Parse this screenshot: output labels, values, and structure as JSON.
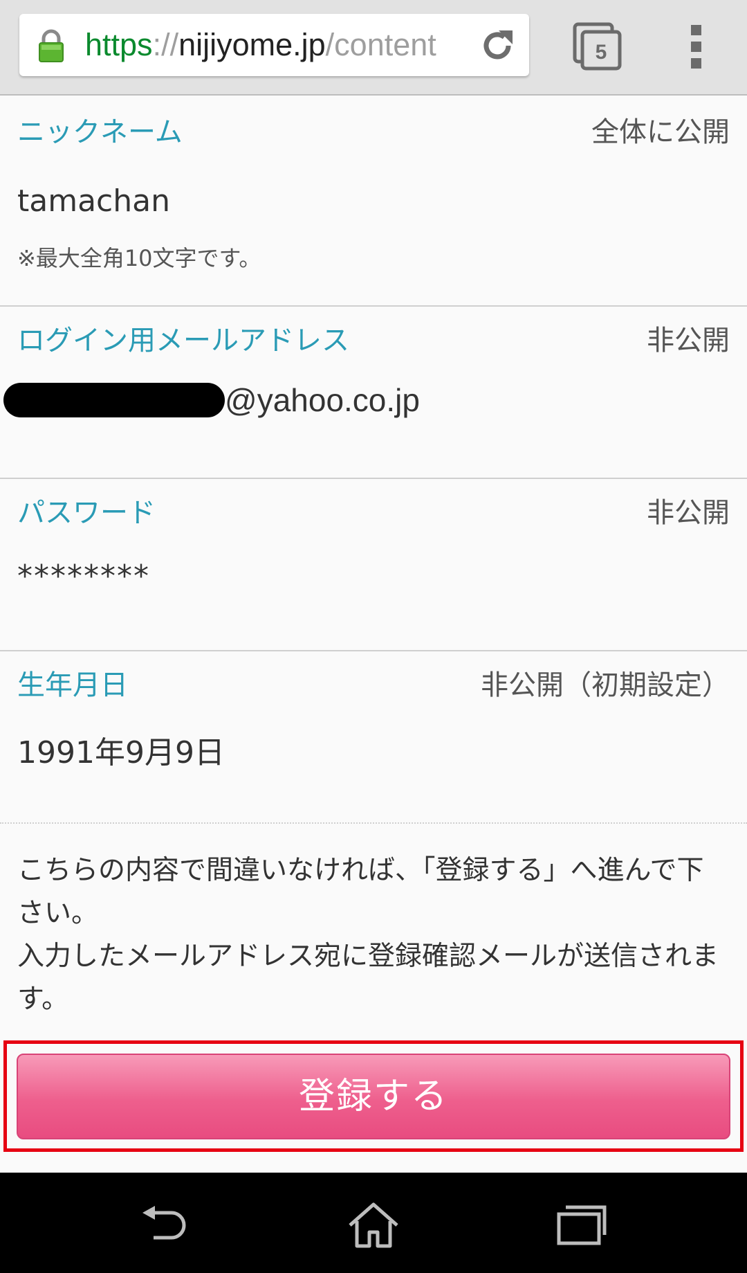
{
  "browser": {
    "url_scheme": "https",
    "url_separator": "://",
    "url_host": "nijiyome.jp",
    "url_path": "/content",
    "tab_count": "5",
    "icons": [
      "lock-icon",
      "reload-icon",
      "tabs-icon",
      "overflow-menu-icon"
    ]
  },
  "form": {
    "nickname": {
      "label": "ニックネーム",
      "visibility": "全体に公開",
      "value": "tamachan",
      "note": "※最大全角10文字です。"
    },
    "email": {
      "label": "ログイン用メールアドレス",
      "visibility": "非公開",
      "value_domain": "@yahoo.co.jp"
    },
    "password": {
      "label": "パスワード",
      "visibility": "非公開",
      "value": "********"
    },
    "birthday": {
      "label": "生年月日",
      "visibility": "非公開（初期設定）",
      "value": "1991年9月9日"
    }
  },
  "notice": {
    "line1": "こちらの内容で間違いなければ、「登録する」へ進んで下さい。",
    "line2": "入力したメールアドレス宛に登録確認メールが送信されます。"
  },
  "register_button_label": "登録する",
  "colors": {
    "label": "#2a9bb5",
    "button": "#ee5f8d",
    "highlight": "#e60012",
    "url_scheme": "#0b8a2e"
  },
  "navbar": {
    "icons": [
      "back-icon",
      "home-icon",
      "recent-apps-icon"
    ]
  }
}
